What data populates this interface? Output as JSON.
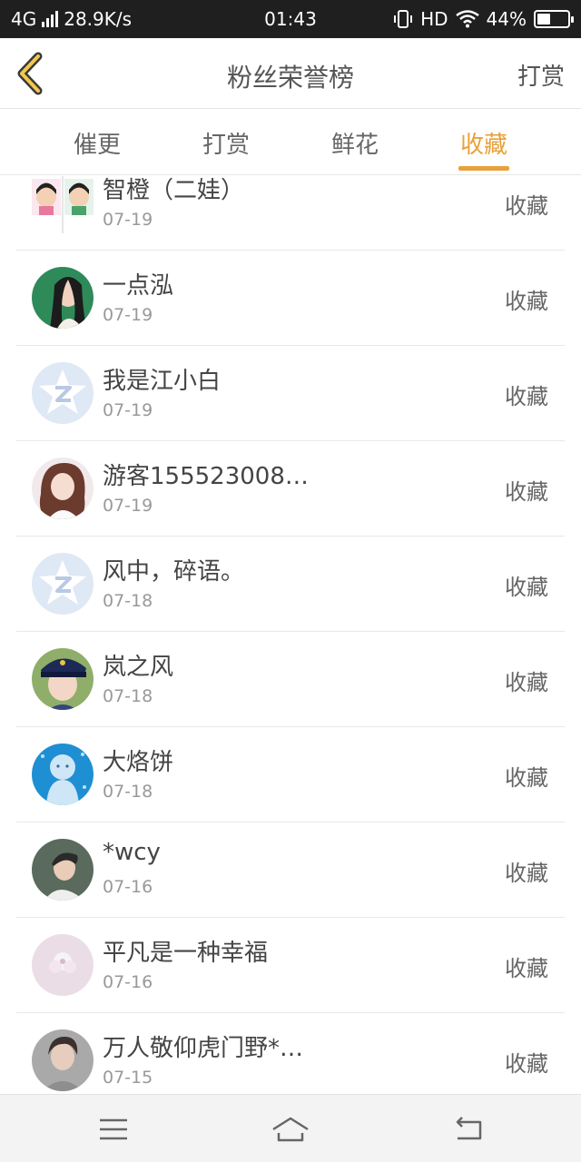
{
  "status_bar": {
    "network": "4G",
    "speed": "28.9K/s",
    "time": "01:43",
    "hd": "HD",
    "battery": "44%",
    "battery_level": 0.44
  },
  "header": {
    "title": "粉丝荣誉榜",
    "right_action": "打赏",
    "back_icon": "chevron-left-icon"
  },
  "tabs": [
    {
      "label": "催更"
    },
    {
      "label": "打赏"
    },
    {
      "label": "鲜花"
    },
    {
      "label": "收藏",
      "active": true
    }
  ],
  "list": [
    {
      "name": "智橙（二娃）",
      "date": "07-19",
      "action": "收藏",
      "avatar": "cartoon-couple"
    },
    {
      "name": "一点泓",
      "date": "07-19",
      "action": "收藏",
      "avatar": "photo"
    },
    {
      "name": "我是江小白",
      "date": "07-19",
      "action": "收藏",
      "avatar": "default-qq"
    },
    {
      "name": "游客155523008…",
      "date": "07-19",
      "action": "收藏",
      "avatar": "photo"
    },
    {
      "name": "风中，碎语。",
      "date": "07-18",
      "action": "收藏",
      "avatar": "default-qq"
    },
    {
      "name": "岚之风",
      "date": "07-18",
      "action": "收藏",
      "avatar": "photo"
    },
    {
      "name": "大烙饼",
      "date": "07-18",
      "action": "收藏",
      "avatar": "illustration"
    },
    {
      "name": "*wcy",
      "date": "07-16",
      "action": "收藏",
      "avatar": "photo"
    },
    {
      "name": "平凡是一种幸福",
      "date": "07-16",
      "action": "收藏",
      "avatar": "photo"
    },
    {
      "name": "万人敬仰虎门野*…",
      "date": "07-15",
      "action": "收藏",
      "avatar": "photo"
    }
  ],
  "nav": {
    "menu_icon": "menu-icon",
    "home_icon": "home-icon",
    "back_icon": "back-icon"
  },
  "colors": {
    "accent": "#e8a13a",
    "status_bar": "#1f1f1f",
    "divider": "#e8e8e8"
  }
}
